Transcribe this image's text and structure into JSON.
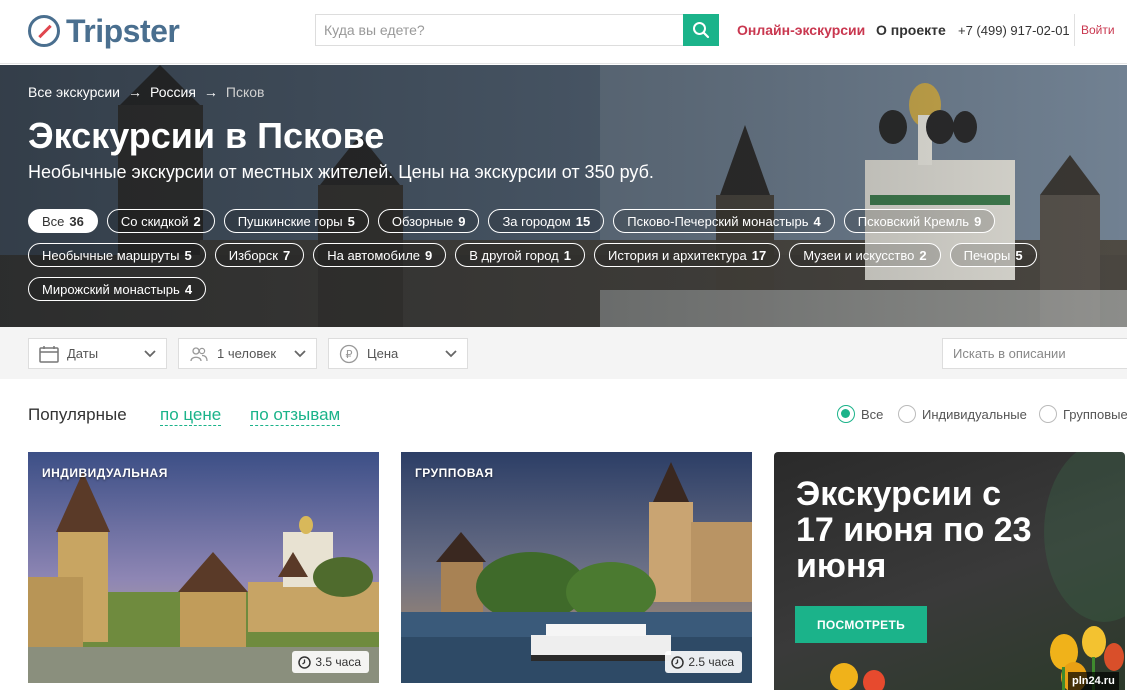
{
  "header": {
    "logo_text": "Tripster",
    "search_placeholder": "Куда вы едете?",
    "nav": {
      "online": "Онлайн-экскурсии",
      "about": "О проекте",
      "phone": "+7 (499) 917-02-01",
      "login": "Войти"
    }
  },
  "hero": {
    "breadcrumb": [
      {
        "label": "Все экскурсии"
      },
      {
        "label": "Россия"
      },
      {
        "label": "Псков"
      }
    ],
    "breadcrumb_arrow": "→",
    "title": "Экскурсии в Пскове",
    "subtitle": "Необычные экскурсии от местных жителей. Цены на экскурсии от 350 руб.",
    "tags": [
      {
        "label": "Все",
        "count": "36",
        "active": true
      },
      {
        "label": "Со скидкой",
        "count": "2"
      },
      {
        "label": "Пушкинские горы",
        "count": "5"
      },
      {
        "label": "Обзорные",
        "count": "9"
      },
      {
        "label": "За городом",
        "count": "15"
      },
      {
        "label": "Псково-Печерский монастырь",
        "count": "4"
      },
      {
        "label": "Псковский Кремль",
        "count": "9"
      },
      {
        "label": "Необычные маршруты",
        "count": "5"
      },
      {
        "label": "Изборск",
        "count": "7"
      },
      {
        "label": "На автомобиле",
        "count": "9"
      },
      {
        "label": "В другой город",
        "count": "1"
      },
      {
        "label": "История и архитектура",
        "count": "17"
      },
      {
        "label": "Музеи и искусство",
        "count": "2"
      },
      {
        "label": "Печоры",
        "count": "5"
      },
      {
        "label": "Мирожский монастырь",
        "count": "4"
      }
    ]
  },
  "filters": {
    "dates": "Даты",
    "people": "1 человек",
    "price": "Цена",
    "search_placeholder": "Искать в описании"
  },
  "sort": {
    "label": "Популярные",
    "by_price": "по цене",
    "by_reviews": "по отзывам",
    "radios": [
      {
        "label": "Все",
        "checked": true
      },
      {
        "label": "Индивидуальные",
        "checked": false
      },
      {
        "label": "Групповые",
        "checked": false
      }
    ]
  },
  "cards": [
    {
      "type": "ИНДИВИДУАЛЬНАЯ",
      "duration": "3.5 часа"
    },
    {
      "type": "ГРУППОВАЯ",
      "duration": "2.5 часа"
    }
  ],
  "promo": {
    "title": "Экскурсии с 17 июня по 23 июня",
    "button": "ПОСМОТРЕТЬ"
  },
  "watermark": "pln24.ru",
  "colors": {
    "accent": "#1bb38a",
    "online": "#c9374f",
    "logo": "#4a6f8f"
  }
}
